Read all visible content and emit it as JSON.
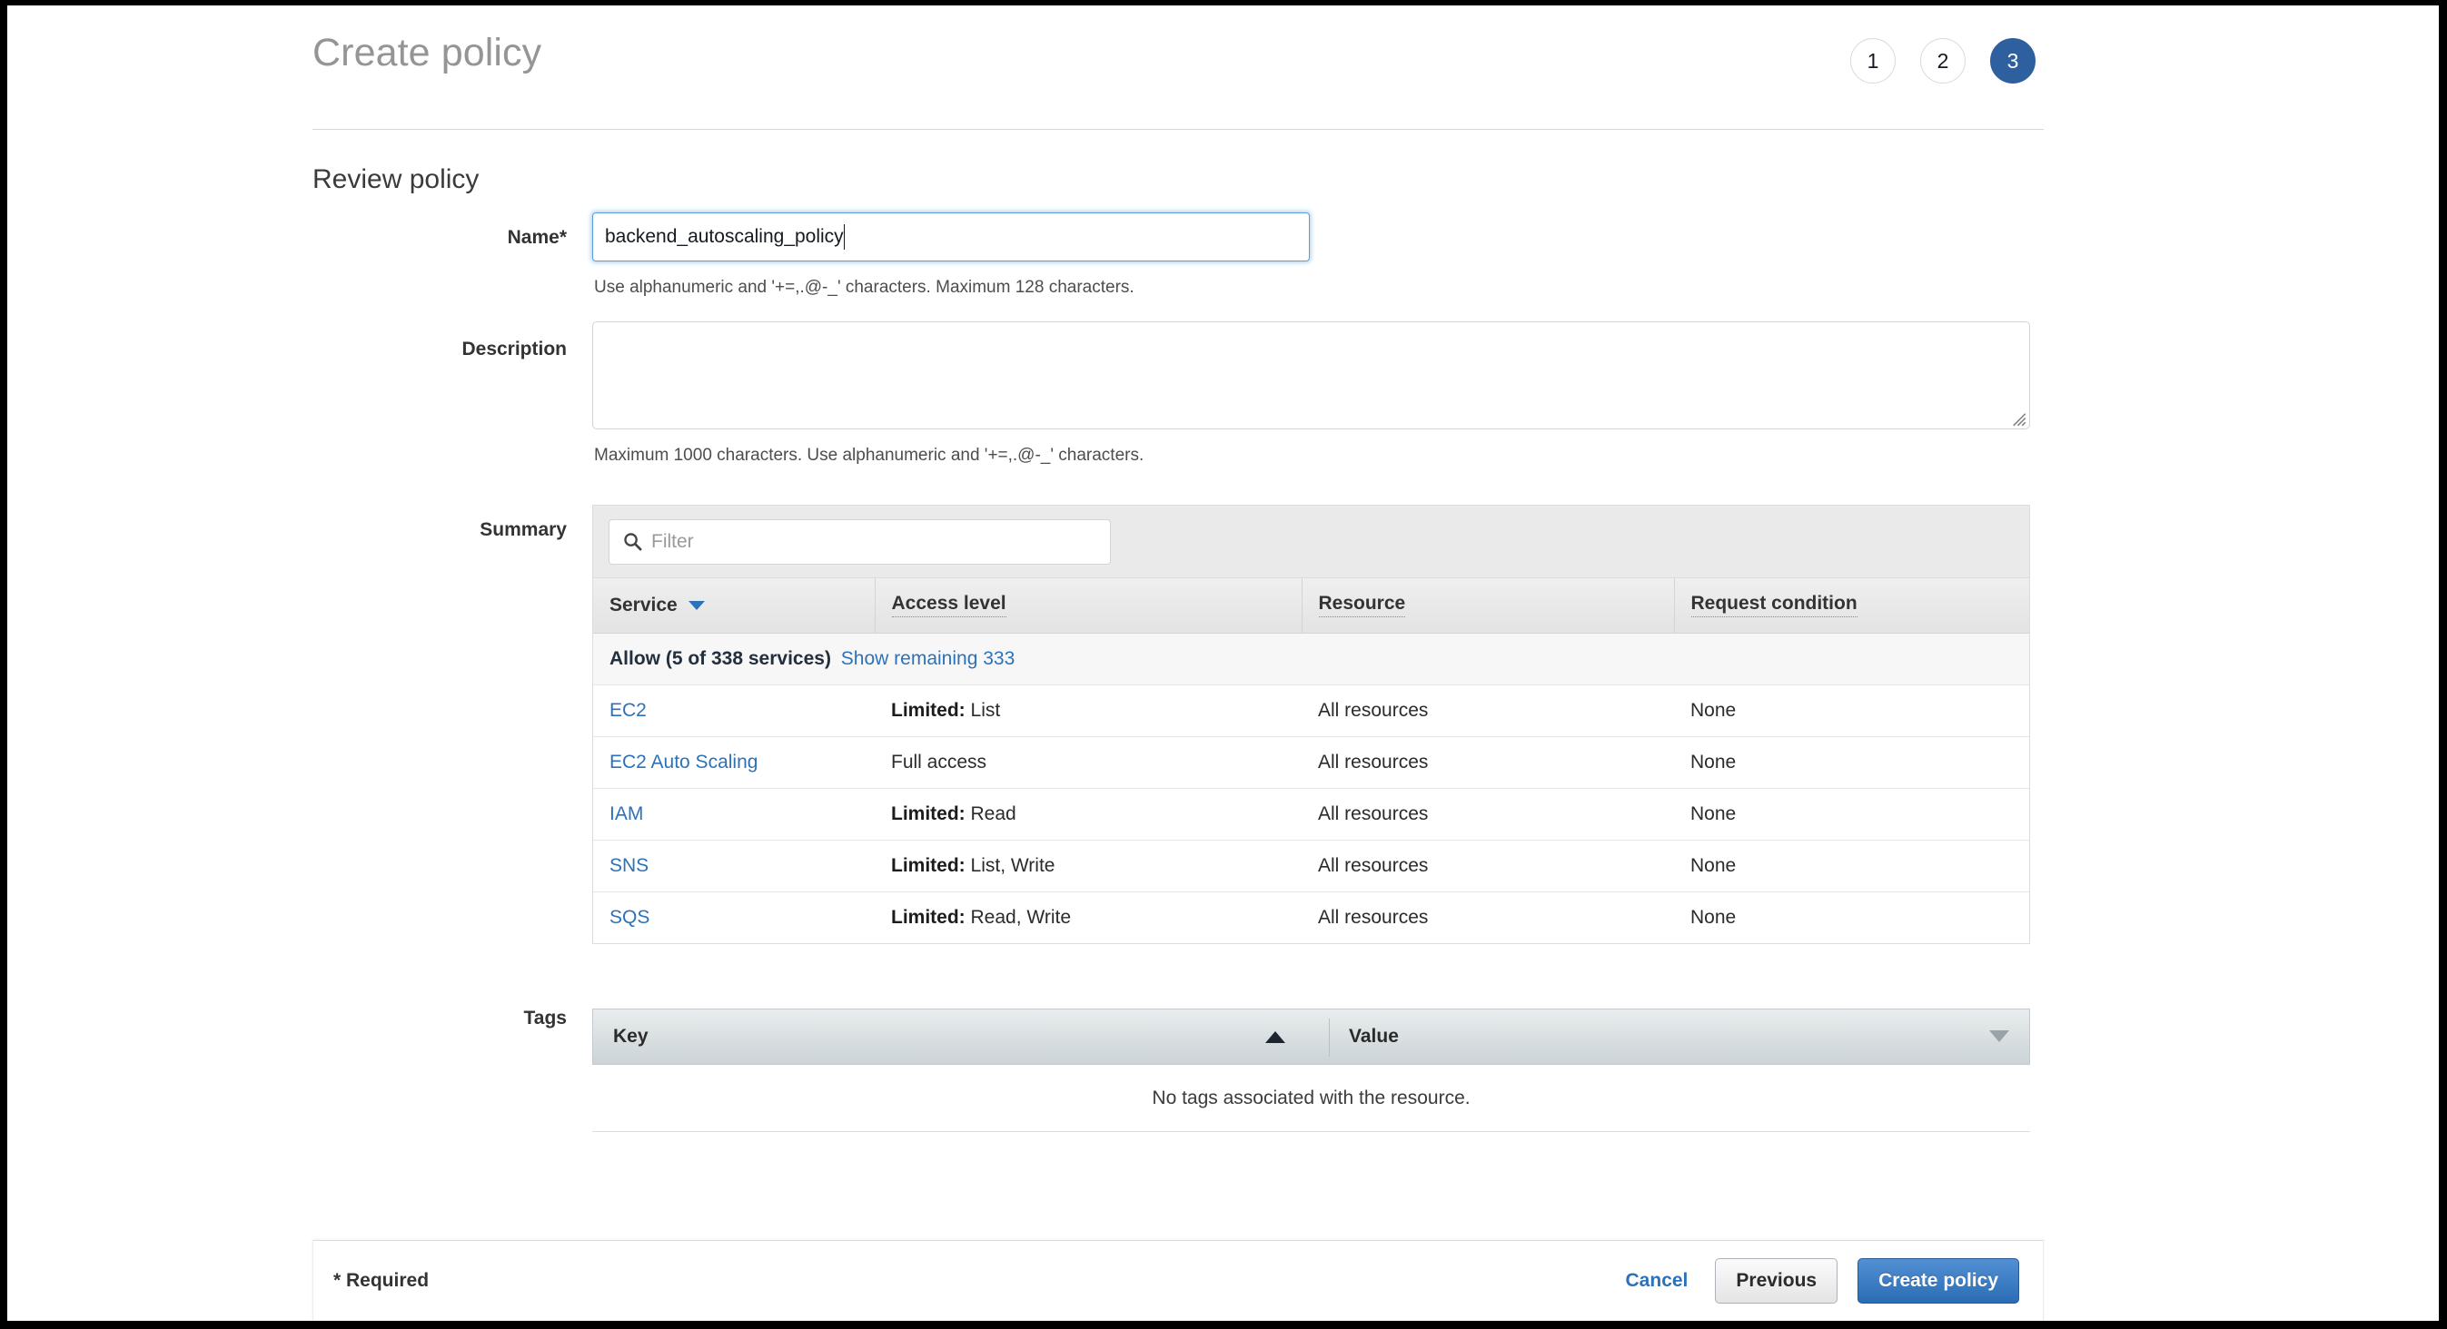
{
  "header": {
    "title": "Create policy",
    "steps": [
      {
        "label": "1",
        "active": false
      },
      {
        "label": "2",
        "active": false
      },
      {
        "label": "3",
        "active": true
      }
    ]
  },
  "section": {
    "heading": "Review policy"
  },
  "form": {
    "name": {
      "label": "Name*",
      "value": "backend_autoscaling_policy",
      "placeholder": "",
      "helper": "Use alphanumeric and '+=,.@-_' characters. Maximum 128 characters."
    },
    "description": {
      "label": "Description",
      "value": "",
      "placeholder": "",
      "helper": "Maximum 1000 characters. Use alphanumeric and '+=,.@-_' characters."
    }
  },
  "summary": {
    "label": "Summary",
    "filter_placeholder": "Filter",
    "filter_value": "",
    "columns": [
      "Service",
      "Access level",
      "Resource",
      "Request condition"
    ],
    "group": {
      "label": "Allow (5 of 338 services)",
      "link": "Show remaining 333"
    },
    "rows": [
      {
        "service": "EC2",
        "access_prefix": "Limited:",
        "access_value": "List",
        "resource": "All resources",
        "condition": "None"
      },
      {
        "service": "EC2 Auto Scaling",
        "access_prefix": "",
        "access_value": "Full access",
        "resource": "All resources",
        "condition": "None"
      },
      {
        "service": "IAM",
        "access_prefix": "Limited:",
        "access_value": "Read",
        "resource": "All resources",
        "condition": "None"
      },
      {
        "service": "SNS",
        "access_prefix": "Limited:",
        "access_value": "List, Write",
        "resource": "All resources",
        "condition": "None"
      },
      {
        "service": "SQS",
        "access_prefix": "Limited:",
        "access_value": "Read, Write",
        "resource": "All resources",
        "condition": "None"
      }
    ]
  },
  "tags": {
    "label": "Tags",
    "columns": [
      "Key",
      "Value"
    ],
    "empty_message": "No tags associated with the resource."
  },
  "footer": {
    "required_note": "* Required",
    "cancel_label": "Cancel",
    "previous_label": "Previous",
    "create_label": "Create policy"
  },
  "colors": {
    "accent_blue": "#2d72b8",
    "step_active": "#2e5f9e",
    "primary_button": "#2a6cb4",
    "title_gray": "#959595"
  }
}
